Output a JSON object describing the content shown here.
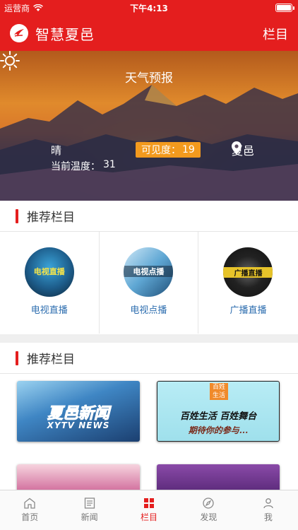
{
  "status": {
    "carrier": "运营商",
    "time": "下午4:13"
  },
  "header": {
    "title": "智慧夏邑",
    "menu_label": "栏目"
  },
  "weather": {
    "title": "天气预报",
    "condition": "晴",
    "temp_label": "当前温度：",
    "temp_value": "31",
    "visibility_label": "可见度：",
    "visibility_value": "19",
    "location": "夏邑"
  },
  "section1": {
    "title": "推荐栏目",
    "channels": [
      {
        "label": "电视直播",
        "thumb_text": "电视直播",
        "icon": "tv-live-thumbnail"
      },
      {
        "label": "电视点播",
        "thumb_text": "电视点播",
        "icon": "tv-vod-thumbnail"
      },
      {
        "label": "广播直播",
        "thumb_text": "广播直播",
        "icon": "radio-live-thumbnail"
      }
    ]
  },
  "section2": {
    "title": "推荐栏目",
    "items": [
      {
        "line1": "夏邑新闻",
        "line2": "XYTV NEWS"
      },
      {
        "badge": "百姓生活",
        "line1": "百姓生活 百姓舞台",
        "line2": "期待你的参与..."
      }
    ]
  },
  "tabs": [
    {
      "label": "首页",
      "icon": "home-icon",
      "active": false
    },
    {
      "label": "新闻",
      "icon": "news-icon",
      "active": false
    },
    {
      "label": "栏目",
      "icon": "grid-icon",
      "active": true
    },
    {
      "label": "发现",
      "icon": "compass-icon",
      "active": false
    },
    {
      "label": "我",
      "icon": "user-icon",
      "active": false
    }
  ],
  "colors": {
    "brand": "#e41e1e",
    "accent_orange": "#f39a1e",
    "link_blue": "#2f6fb0"
  }
}
